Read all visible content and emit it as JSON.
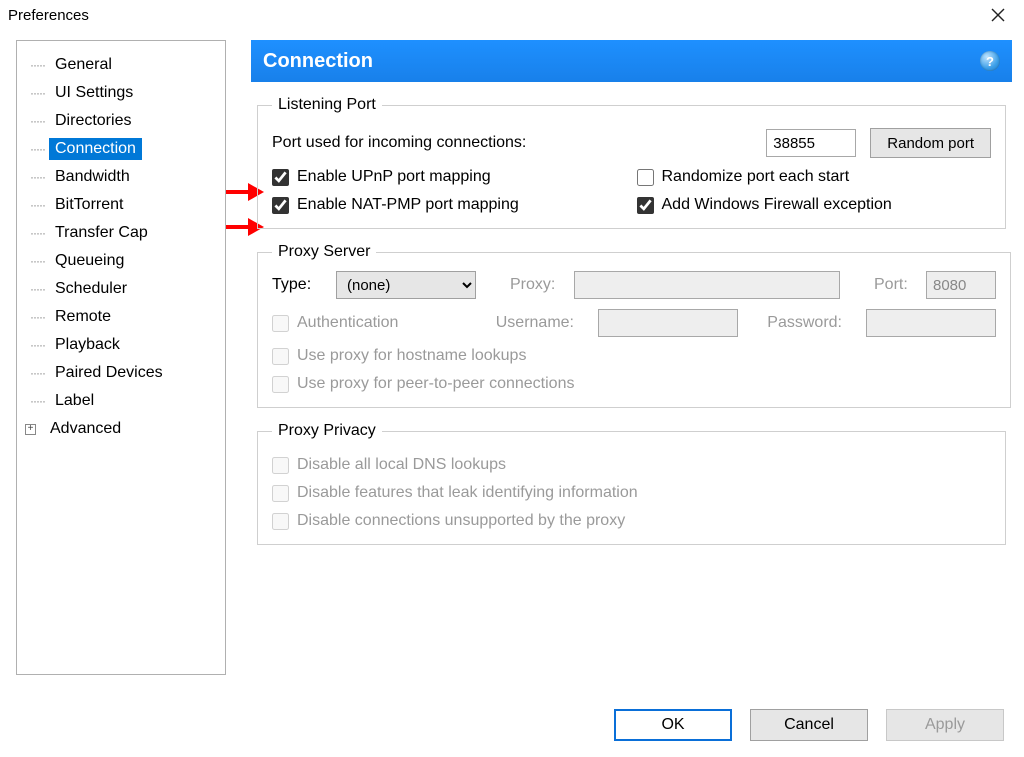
{
  "window": {
    "title": "Preferences"
  },
  "sidebar": {
    "items": [
      {
        "label": "General",
        "selected": false,
        "expand": false
      },
      {
        "label": "UI Settings",
        "selected": false,
        "expand": false
      },
      {
        "label": "Directories",
        "selected": false,
        "expand": false
      },
      {
        "label": "Connection",
        "selected": true,
        "expand": false
      },
      {
        "label": "Bandwidth",
        "selected": false,
        "expand": false
      },
      {
        "label": "BitTorrent",
        "selected": false,
        "expand": false
      },
      {
        "label": "Transfer Cap",
        "selected": false,
        "expand": false
      },
      {
        "label": "Queueing",
        "selected": false,
        "expand": false
      },
      {
        "label": "Scheduler",
        "selected": false,
        "expand": false
      },
      {
        "label": "Remote",
        "selected": false,
        "expand": false
      },
      {
        "label": "Playback",
        "selected": false,
        "expand": false
      },
      {
        "label": "Paired Devices",
        "selected": false,
        "expand": false
      },
      {
        "label": "Label",
        "selected": false,
        "expand": false
      },
      {
        "label": "Advanced",
        "selected": false,
        "expand": true
      }
    ]
  },
  "panel": {
    "title": "Connection",
    "help_icon": "?",
    "listening": {
      "legend": "Listening Port",
      "port_label": "Port used for incoming connections:",
      "port_value": "38855",
      "random_button": "Random port",
      "upnp": {
        "label": "Enable UPnP port mapping",
        "checked": true
      },
      "randomize": {
        "label": "Randomize port each start",
        "checked": false
      },
      "natpmp": {
        "label": "Enable NAT-PMP port mapping",
        "checked": true
      },
      "firewall": {
        "label": "Add Windows Firewall exception",
        "checked": true
      }
    },
    "proxy": {
      "legend": "Proxy Server",
      "type_label": "Type:",
      "type_value": "(none)",
      "proxy_label": "Proxy:",
      "proxy_value": "",
      "port_label": "Port:",
      "port_value": "8080",
      "auth": {
        "label": "Authentication",
        "checked": false
      },
      "user_label": "Username:",
      "user_value": "",
      "pass_label": "Password:",
      "pass_value": "",
      "hostname": {
        "label": "Use proxy for hostname lookups",
        "checked": false
      },
      "p2p": {
        "label": "Use proxy for peer-to-peer connections",
        "checked": false
      }
    },
    "privacy": {
      "legend": "Proxy Privacy",
      "dns": {
        "label": "Disable all local DNS lookups",
        "checked": false
      },
      "leak": {
        "label": "Disable features that leak identifying information",
        "checked": false
      },
      "unsup": {
        "label": "Disable connections unsupported by the proxy",
        "checked": false
      }
    }
  },
  "buttons": {
    "ok": "OK",
    "cancel": "Cancel",
    "apply": "Apply"
  }
}
